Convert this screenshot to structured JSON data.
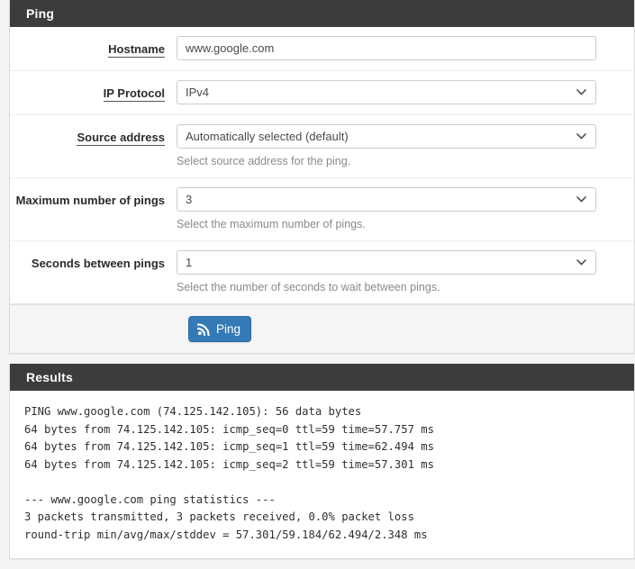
{
  "ping_panel": {
    "title": "Ping",
    "rows": [
      {
        "label": "Hostname",
        "underline": true,
        "control": "input",
        "value": "www.google.com",
        "placeholder": "Hostname",
        "help": ""
      },
      {
        "label": "IP Protocol",
        "underline": true,
        "control": "select",
        "value": "IPv4",
        "help": ""
      },
      {
        "label": "Source address",
        "underline": true,
        "control": "select",
        "value": "Automatically selected (default)",
        "help": "Select source address for the ping."
      },
      {
        "label": "Maximum number of pings",
        "underline": false,
        "control": "select",
        "value": "3",
        "help": "Select the maximum number of pings."
      },
      {
        "label": "Seconds between pings",
        "underline": false,
        "control": "select",
        "value": "1",
        "help": "Select the number of seconds to wait between pings."
      }
    ],
    "submit_button": {
      "label": "Ping",
      "icon": "rss-signal-icon",
      "color": "#337ab7"
    }
  },
  "results_panel": {
    "title": "Results",
    "output": "PING www.google.com (74.125.142.105): 56 data bytes\n64 bytes from 74.125.142.105: icmp_seq=0 ttl=59 time=57.757 ms\n64 bytes from 74.125.142.105: icmp_seq=1 ttl=59 time=62.494 ms\n64 bytes from 74.125.142.105: icmp_seq=2 ttl=59 time=57.301 ms\n\n--- www.google.com ping statistics ---\n3 packets transmitted, 3 packets received, 0.0% packet loss\nround-trip min/avg/max/stddev = 57.301/59.184/62.494/2.348 ms"
  },
  "theme": {
    "header_bg": "#3c3c3c",
    "page_bg": "#f4f4f4",
    "accent": "#337ab7"
  }
}
